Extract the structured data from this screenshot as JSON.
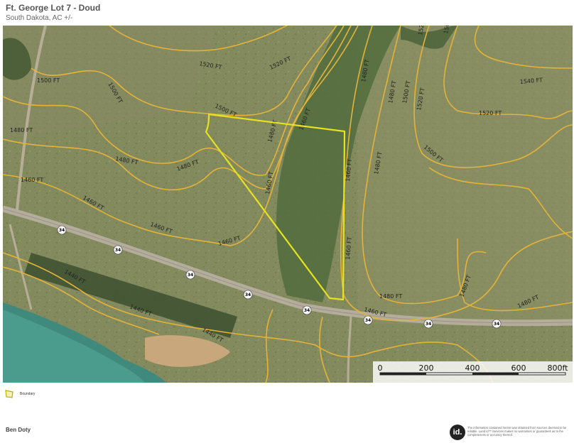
{
  "header": {
    "title": "Ft. George Lot 7 - Doud",
    "subtitle": "South Dakota,  AC +/-"
  },
  "legend": {
    "boundary_label": "Boundary",
    "boundary_color": "#e6e21f"
  },
  "contour_color": "#e3b33a",
  "contour_labels": [
    "1540 FT",
    "1520 FT",
    "1520 FT",
    "1520 FT",
    "1500 FT",
    "1500 FT",
    "1500 FT",
    "1500 FT",
    "1480 FT",
    "1480 FT",
    "1480 FT",
    "1480 FT",
    "1480 FT",
    "1480 FT",
    "1480 FT",
    "1480 FT",
    "1460 FT",
    "1460 FT",
    "1460 FT",
    "1460 FT",
    "1460 FT",
    "1460 FT",
    "1460 FT",
    "1460 FT",
    "1440 FT",
    "1440 FT",
    "1440 FT",
    "1520 FT",
    "1500 FT",
    "1480 FT",
    "1460 FT",
    "1480 FT",
    "1500 FT",
    "1520 FT"
  ],
  "highway_shields": [
    "34",
    "34",
    "34",
    "34",
    "34",
    "34",
    "34",
    "34"
  ],
  "scale": {
    "labels": [
      "0",
      "200",
      "400",
      "600",
      "800ft"
    ]
  },
  "footer": {
    "agent": "Ben Doty",
    "logo": "id.",
    "disclaimer": "The information contained herein was obtained from sources deemed to be reliable. Land id™ Services makes no warranties or guarantees as to the completeness or accuracy thereof."
  }
}
